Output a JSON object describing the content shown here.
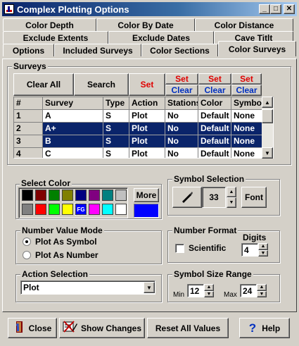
{
  "window": {
    "title": "Complex Plotting Options"
  },
  "tabs": {
    "row1": [
      "Color Depth",
      "Color By Date",
      "Color Distance"
    ],
    "row2": [
      "Exclude Extents",
      "Exclude Dates",
      "Cave Titlt"
    ],
    "row3": [
      "Options",
      "Included Surveys",
      "Color Sections",
      "Color Surveys"
    ],
    "active": "Color Surveys"
  },
  "surveys": {
    "group_label": "Surveys",
    "clear_all_label": "Clear All",
    "search_label": "Search",
    "set_label": "Set",
    "column_set_labels": [
      "Set",
      "Set",
      "Set"
    ],
    "column_clear_labels": [
      "Clear",
      "Clear",
      "Clear"
    ],
    "columns": [
      "#",
      "Survey",
      "Type",
      "Action",
      "Stations",
      "Color",
      "Symbol"
    ],
    "rows": [
      {
        "num": "1",
        "survey": "A",
        "type": "S",
        "action": "Plot",
        "stations": "No",
        "color": "Default",
        "symbol": "None",
        "selected": false
      },
      {
        "num": "2",
        "survey": "A+",
        "type": "S",
        "action": "Plot",
        "stations": "No",
        "color": "Default",
        "symbol": "None",
        "selected": true
      },
      {
        "num": "3",
        "survey": "B",
        "type": "S",
        "action": "Plot",
        "stations": "No",
        "color": "Default",
        "symbol": "None",
        "selected": true
      },
      {
        "num": "4",
        "survey": "C",
        "type": "S",
        "action": "Plot",
        "stations": "No",
        "color": "Default",
        "symbol": "None",
        "selected": false
      }
    ]
  },
  "select_color": {
    "label": "Select Color",
    "more_label": "More",
    "fg_label": "FG",
    "palette": [
      "#000000",
      "#800000",
      "#008000",
      "#808000",
      "#000080",
      "#800080",
      "#008080",
      "#c0c0c0",
      "#808080",
      "#ff0000",
      "#00ff00",
      "#ffff00",
      "#0000ff",
      "#ff00ff",
      "#00ffff",
      "#ffffff"
    ],
    "current_color": "#0000ff"
  },
  "symbol_selection": {
    "label": "Symbol Selection",
    "value": "33",
    "font_label": "Font",
    "symbol_icon": "pen-nib-icon"
  },
  "number_value_mode": {
    "label": "Number Value Mode",
    "options": [
      "Plot As Symbol",
      "Plot As Number"
    ],
    "selected": "Plot As Symbol"
  },
  "number_format": {
    "label": "Number Format",
    "scientific_label": "Scientific",
    "scientific_checked": false,
    "digits_label": "Digits",
    "digits_value": "4"
  },
  "action_selection": {
    "label": "Action Selection",
    "value": "Plot"
  },
  "symbol_size_range": {
    "label": "Symbol Size Range",
    "min_label": "Min",
    "min_value": "12",
    "max_label": "Max",
    "max_value": "24"
  },
  "footer": {
    "close_label": "Close",
    "show_changes_label": "Show Changes",
    "reset_label": "Reset All Values",
    "help_label": "Help"
  }
}
